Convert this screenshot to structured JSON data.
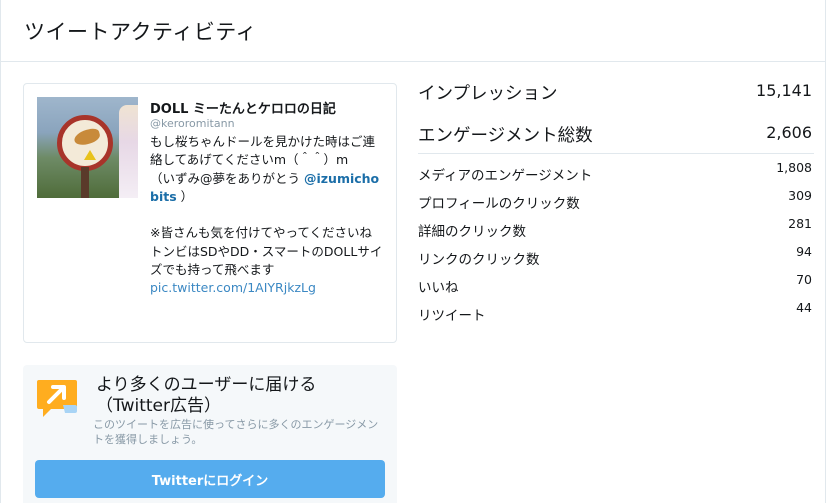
{
  "header": {
    "title": "ツイートアクティビティ"
  },
  "tweet": {
    "author_name": "DOLL ミーたんとケロロの日記",
    "handle": "@keroromitann",
    "text_part1": "もし桜ちゃんドールを見かけた時はご連絡してあげてくださいm（＾＾）m\n（いずみ@夢をありがとう ",
    "mention": "@izumichobits",
    "text_part2": " ）\n\n※皆さんも気を付けてやってくださいね\nトンビはSDやDD・スマートのDOLLサイズでも持って飛べます\n",
    "link": "pic.twitter.com/1AIYRjkzLg",
    "thumbnail_icon": "photo-thumbnail"
  },
  "promo": {
    "title": "より多くのユーザーに届ける（Twitter広告）",
    "description": "このツイートを広告に使ってさらに多くのエンゲージメントを獲得しましょう。",
    "button_label": "Twitterにログイン",
    "icon": "promote-arrow-icon",
    "accent_color": "#55acee",
    "icon_color": "#ffad1f"
  },
  "stats": {
    "impressions": {
      "label": "インプレッション",
      "value": "15,141"
    },
    "engagements": {
      "label": "エンゲージメント総数",
      "value": "2,606"
    },
    "breakdown": [
      {
        "label": "メディアのエンゲージメント",
        "value": "1,808"
      },
      {
        "label": "プロフィールのクリック数",
        "value": "309"
      },
      {
        "label": "詳細のクリック数",
        "value": "281"
      },
      {
        "label": "リンクのクリック数",
        "value": "94"
      },
      {
        "label": "いいね",
        "value": "70"
      },
      {
        "label": "リツイート",
        "value": "44"
      }
    ]
  }
}
